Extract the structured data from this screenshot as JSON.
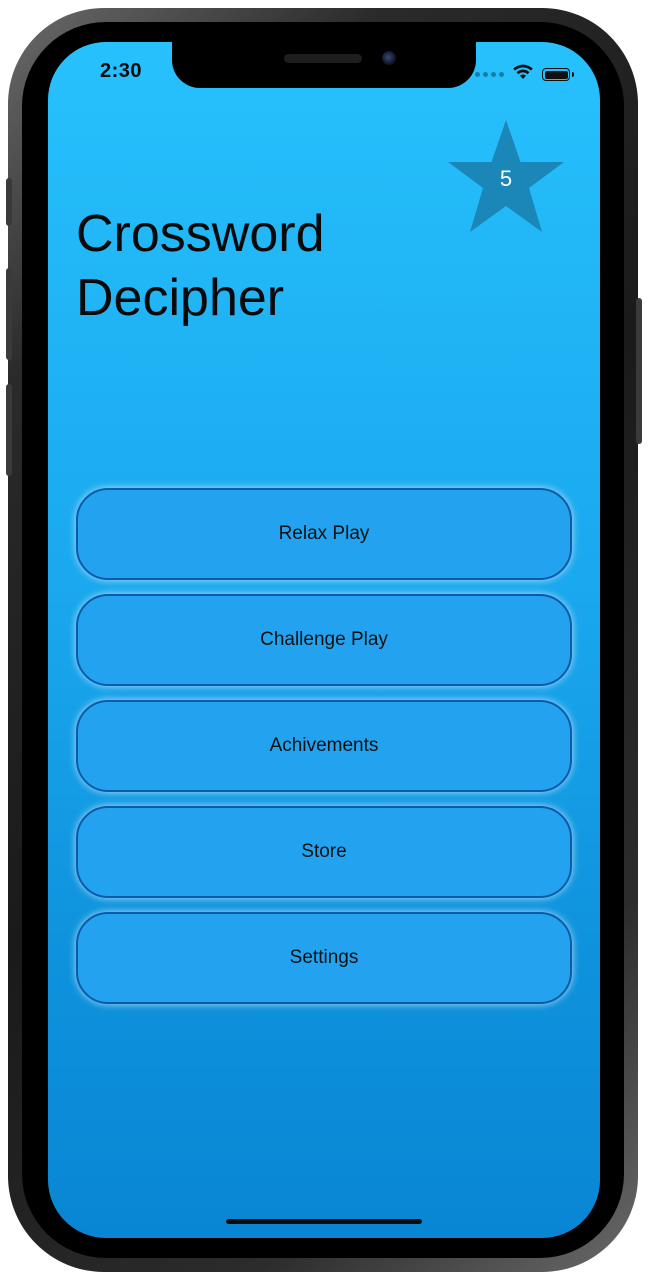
{
  "status_bar": {
    "time": "2:30",
    "wifi_icon": "wifi-icon",
    "battery_icon": "battery-icon"
  },
  "badge": {
    "icon": "star-icon",
    "count": "5",
    "color": "#1b86b8"
  },
  "app": {
    "title_line1": "Crossword",
    "title_line2": "Decipher"
  },
  "menu": {
    "items": [
      {
        "label": "Relax Play"
      },
      {
        "label": "Challenge Play"
      },
      {
        "label": "Achivements"
      },
      {
        "label": "Store"
      },
      {
        "label": "Settings"
      }
    ]
  },
  "colors": {
    "background_top": "#27c1fd",
    "background_bottom": "#0986d3",
    "button_fill": "#23a3ef",
    "button_border": "#0d5aa8"
  }
}
